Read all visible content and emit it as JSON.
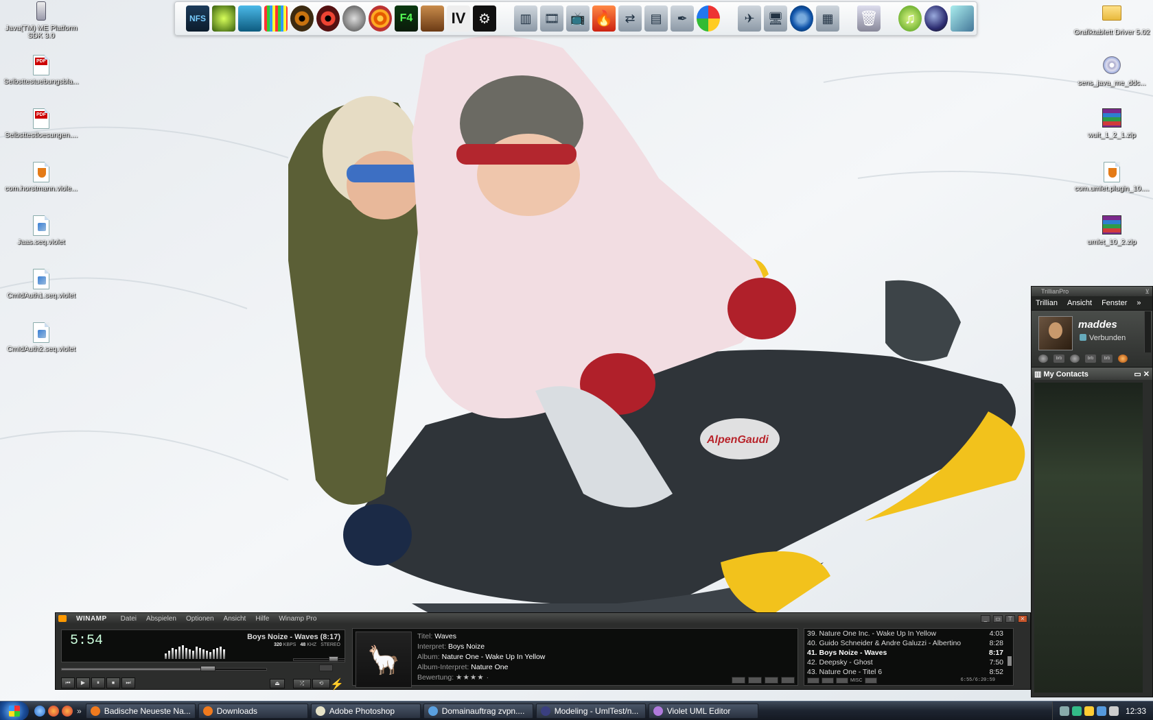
{
  "desktop": {
    "left_icons": [
      {
        "label": "Java(TM) ME Platform SDK 3.0",
        "kind": "phone"
      },
      {
        "label": "Selbsttestuebungsbla...",
        "kind": "pdf"
      },
      {
        "label": "Selbsttestloesungen....",
        "kind": "pdf"
      },
      {
        "label": "com.horstmann.viole...",
        "kind": "java"
      },
      {
        "label": "Jaas.seq.violet",
        "kind": "violet"
      },
      {
        "label": "CmIdAuth1.seq.violet",
        "kind": "violet"
      },
      {
        "label": "CmIdAuth2.seq.violet",
        "kind": "violet"
      }
    ],
    "right_icons": [
      {
        "label": "Grafiktablett Driver 5.02",
        "kind": "folder"
      },
      {
        "label": "sens_java_me_ddc...",
        "kind": "cd"
      },
      {
        "label": "wuit_1_2_1.zip",
        "kind": "zip"
      },
      {
        "label": "com.umlet.plugin_10....",
        "kind": "java"
      },
      {
        "label": "umlet_10_2.zip",
        "kind": "zip"
      }
    ],
    "pdf_badge": "PDF",
    "wallpaper_logo": "AlpenGaudi"
  },
  "dock": {
    "group1": [
      {
        "name": "nfs-icon",
        "glyph": "NFS",
        "cls": "dk-nfs"
      },
      {
        "name": "green-game-icon",
        "glyph": "",
        "cls": "dk-green"
      },
      {
        "name": "palm-icon",
        "glyph": "",
        "cls": "dk-palm"
      },
      {
        "name": "pixel-game-icon",
        "glyph": "",
        "cls": "dk-pix"
      },
      {
        "name": "eye-icon",
        "glyph": "",
        "cls": "dk-eye"
      },
      {
        "name": "red-eye-icon",
        "glyph": "",
        "cls": "dk-eye2"
      },
      {
        "name": "robot-icon",
        "glyph": "",
        "cls": "dk-robot"
      },
      {
        "name": "spiral-icon",
        "glyph": "",
        "cls": "dk-spiral"
      },
      {
        "name": "f4-game-icon",
        "glyph": "F4",
        "cls": "dk-f4"
      },
      {
        "name": "character-game-icon",
        "glyph": "",
        "cls": "dk-man"
      },
      {
        "name": "gta-iv-icon",
        "glyph": "IV",
        "cls": "dk-iv"
      },
      {
        "name": "steam-icon",
        "glyph": "⚙",
        "cls": "dk-steam"
      }
    ],
    "group2": [
      {
        "name": "bookshelf-icon",
        "glyph": "▥",
        "cls": "dk-generic"
      },
      {
        "name": "movie-icon",
        "glyph": "🎞",
        "cls": "dk-generic"
      },
      {
        "name": "tv-icon",
        "glyph": "📺",
        "cls": "dk-generic"
      },
      {
        "name": "burn-icon",
        "glyph": "🔥",
        "cls": "dk-red"
      },
      {
        "name": "network-icon",
        "glyph": "⇄",
        "cls": "dk-generic"
      },
      {
        "name": "documents-icon",
        "glyph": "▤",
        "cls": "dk-generic"
      },
      {
        "name": "feather-icon",
        "glyph": "✒",
        "cls": "dk-generic"
      },
      {
        "name": "picasa-icon",
        "glyph": "",
        "cls": "dk-picasa"
      }
    ],
    "group3": [
      {
        "name": "plane-icon",
        "glyph": "✈",
        "cls": "dk-generic"
      },
      {
        "name": "monitor-icon",
        "glyph": "🖥",
        "cls": "dk-generic"
      },
      {
        "name": "globe-icon",
        "glyph": "",
        "cls": "dk-blue"
      },
      {
        "name": "grid-icon",
        "glyph": "▦",
        "cls": "dk-generic"
      }
    ],
    "group4": [
      {
        "name": "recycle-bin-icon",
        "glyph": "🗑",
        "cls": "dk-bin"
      }
    ],
    "group5": [
      {
        "name": "itunes-icon",
        "glyph": "♫",
        "cls": "dk-itunes"
      },
      {
        "name": "eclipse-icon",
        "glyph": "",
        "cls": "dk-eclipse"
      },
      {
        "name": "virtualbox-icon",
        "glyph": "",
        "cls": "dk-cube"
      }
    ]
  },
  "trillian": {
    "title": "TrillianPro",
    "menu": [
      "Trillian",
      "Ansicht",
      "Fenster"
    ],
    "menu_more": "»",
    "user": "maddes",
    "status": "Verbunden",
    "service_labels": [
      "brb",
      "brb",
      "brb"
    ],
    "contacts_title": "My Contacts"
  },
  "winamp": {
    "brand": "WINAMP",
    "menu": [
      "Datei",
      "Abspielen",
      "Optionen",
      "Ansicht",
      "Hilfe",
      "Winamp Pro"
    ],
    "time": "5:54",
    "now_playing": "Boys Noize - Waves (8:17)",
    "kbps": "320",
    "kbps_unit": "KBPS",
    "khz": "48",
    "khz_unit": "KHZ",
    "mode": "STEREO",
    "seek_fraction": 0.71,
    "volume_fraction": 0.85,
    "meta": {
      "title_key": "Titel:",
      "title": "Waves",
      "artist_key": "Interpret:",
      "artist": "Boys Noize",
      "album_key": "Album:",
      "album": "Nature One - Wake Up In Yellow",
      "album_artist_key": "Album-Interpret:",
      "album_artist": "Nature One",
      "rating_key": "Bewertung:",
      "rating": "★★★★",
      "rating_rest": "·"
    },
    "playlist": [
      {
        "title": "39. Nature One Inc. - Wake Up In Yellow",
        "time": "4:03"
      },
      {
        "title": "40. Guido Schneider & Andre Galuzzi - Albertino",
        "time": "8:28"
      },
      {
        "title": "41. Boys Noize - Waves",
        "time": "8:17",
        "current": true
      },
      {
        "title": "42. Deepsky - Ghost",
        "time": "7:50"
      },
      {
        "title": "43. Nature One - Titel 6",
        "time": "8:52"
      }
    ],
    "playlist_total": "6:55/6:20:59",
    "playlist_misc": "MISC",
    "controls": [
      "⏮",
      "▶",
      "⏸",
      "⏹",
      "⏭"
    ],
    "eject": "⏏"
  },
  "taskbar": {
    "tasks": [
      {
        "label": "Badische Neueste Na...",
        "color": "#f07a1e"
      },
      {
        "label": "Downloads",
        "color": "#f07a1e"
      },
      {
        "label": "Adobe Photoshop",
        "color": "#e7e3c8"
      },
      {
        "label": "Domainauftrag zvpn....",
        "color": "#5aa0e0"
      },
      {
        "label": "Modeling - UmlTest/n...",
        "color": "#3a3f80"
      },
      {
        "label": "Violet UML Editor",
        "color": "#b07adc"
      }
    ],
    "quicklaunch_more": "»",
    "clock": "12:33"
  }
}
